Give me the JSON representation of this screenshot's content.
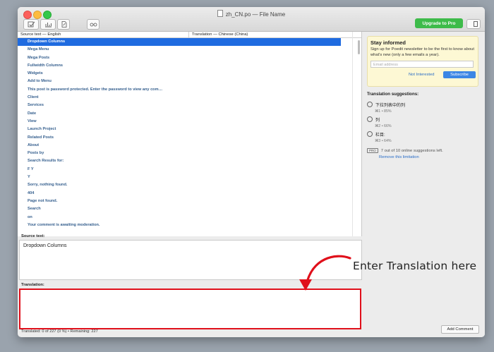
{
  "window": {
    "title": "zh_CN.po — File Name"
  },
  "toolbar": {
    "upgrade_label": "Upgrade to Pro"
  },
  "list": {
    "col_source": "Source text — English",
    "col_translation": "Translation — Chinese (China)",
    "rows": [
      "Dropdown Columns",
      "Mega Menu",
      "Mega Posts",
      "Fullwidth Columns",
      "Widgets",
      "Add to Menu",
      "This post is password protected. Enter the password to view any com…",
      "Client",
      "Services",
      "Date",
      "View",
      "Launch Project",
      "Related Posts",
      "About",
      "Posts by",
      "Search Results for:",
      "F Y",
      "Y",
      "Sorry, nothing found.",
      "404",
      "Page not found.",
      "Search",
      "on",
      "Your comment is awaiting moderation."
    ]
  },
  "source": {
    "label": "Source text:",
    "text": "Dropdown Columns"
  },
  "translation": {
    "label": "Translation:"
  },
  "status": {
    "text": "Translated: 0 of 227 (0 %)  •  Remaining: 227"
  },
  "panel": {
    "stay_title": "Stay informed",
    "stay_text": "Sign up for Poedit newsletter to be the first to know about what's new (only a few emails a year).",
    "email_placeholder": "Email address",
    "not_interested": "Not Interested",
    "subscribe": "Subscribe",
    "suggestions_title": "Translation suggestions:",
    "suggestions": [
      {
        "text": "下拉列表中的列",
        "meta": "⌘1 • 85%"
      },
      {
        "text": "列",
        "meta": "⌘2 • 66%"
      },
      {
        "text": "栏目:",
        "meta": "⌘3 • 64%"
      }
    ],
    "pro_badge": "PRO",
    "pro_note": "7 out of 10 online suggestions left.",
    "remove_limit": "Remove this limitation",
    "add_comment": "Add Comment"
  },
  "annotation": {
    "text": "Enter Translation here",
    "color": "#e0101b"
  }
}
